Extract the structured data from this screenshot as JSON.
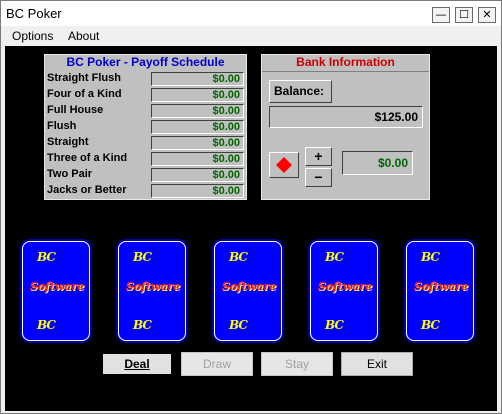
{
  "window": {
    "title": "BC Poker"
  },
  "titlebar_buttons": {
    "minimize": "—",
    "maximize": "☐",
    "close": "✕"
  },
  "menu": {
    "items": [
      "Options",
      "About"
    ]
  },
  "payoff": {
    "title": "BC Poker - Payoff Schedule",
    "rows": [
      {
        "hand": "Straight Flush",
        "value": "$0.00"
      },
      {
        "hand": "Four of a Kind",
        "value": "$0.00"
      },
      {
        "hand": "Full House",
        "value": "$0.00"
      },
      {
        "hand": "Flush",
        "value": "$0.00"
      },
      {
        "hand": "Straight",
        "value": "$0.00"
      },
      {
        "hand": "Three of a Kind",
        "value": "$0.00"
      },
      {
        "hand": "Two Pair",
        "value": "$0.00"
      },
      {
        "hand": "Jacks or Better",
        "value": "$0.00"
      }
    ]
  },
  "bank": {
    "title": "Bank Information",
    "balance_label": "Balance:",
    "balance": "$125.00",
    "plus": "+",
    "minus": "−",
    "bet": "$0.00"
  },
  "cards": [
    {
      "top": "BC",
      "middle": "Software",
      "bottom": "BC"
    },
    {
      "top": "BC",
      "middle": "Software",
      "bottom": "BC"
    },
    {
      "top": "BC",
      "middle": "Software",
      "bottom": "BC"
    },
    {
      "top": "BC",
      "middle": "Software",
      "bottom": "BC"
    },
    {
      "top": "BC",
      "middle": "Software",
      "bottom": "BC"
    }
  ],
  "buttons": {
    "deal": "Deal",
    "draw": "Draw",
    "stay": "Stay",
    "exit": "Exit"
  },
  "colors": {
    "table": "#000000",
    "panel": "#c0c0c0",
    "card_back": "#0000ff",
    "payoff_title": "#0000cc",
    "bank_title": "#cc0000",
    "money": "#006600"
  }
}
